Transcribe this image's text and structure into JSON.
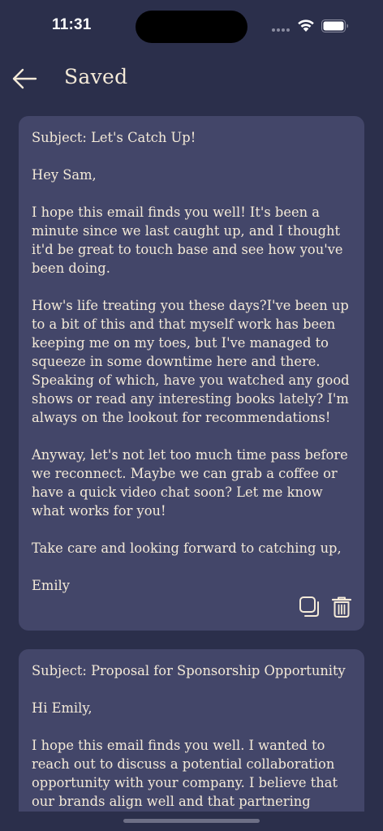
{
  "status_bar": {
    "time": "11:31"
  },
  "header": {
    "title": "Saved",
    "back_icon": "arrow-left-icon"
  },
  "saved_emails": [
    {
      "text": "Subject: Let's Catch Up!\n\nHey Sam,\n\nI hope this email finds you well! It's been a minute since we last caught up, and I thought it'd be great to touch base and see how you've been doing.\n\nHow's life treating you these days?I've been up to a bit of this and that myself work has been keeping me on my toes, but I've managed to squeeze in some downtime here and there. Speaking of which, have you watched any good shows or read any interesting books lately? I'm always on the lookout for recommendations!\n\nAnyway, let's not let too much time pass before we reconnect. Maybe we can grab a coffee or have a quick video chat soon? Let me know what works for you!\n\nTake care and looking forward to catching up,\n\nEmily",
      "actions": [
        "copy-icon",
        "trash-icon"
      ]
    },
    {
      "text": "Subject: Proposal for Sponsorship Opportunity\n\nHi Emily,\n\nI hope this email finds you well. I wanted to reach out to discuss a potential collaboration opportunity with your company. I believe that our brands align well and that partnering"
    }
  ],
  "colors": {
    "background": "#2b2f4b",
    "card": "#434669",
    "text": "#f4ead8"
  }
}
